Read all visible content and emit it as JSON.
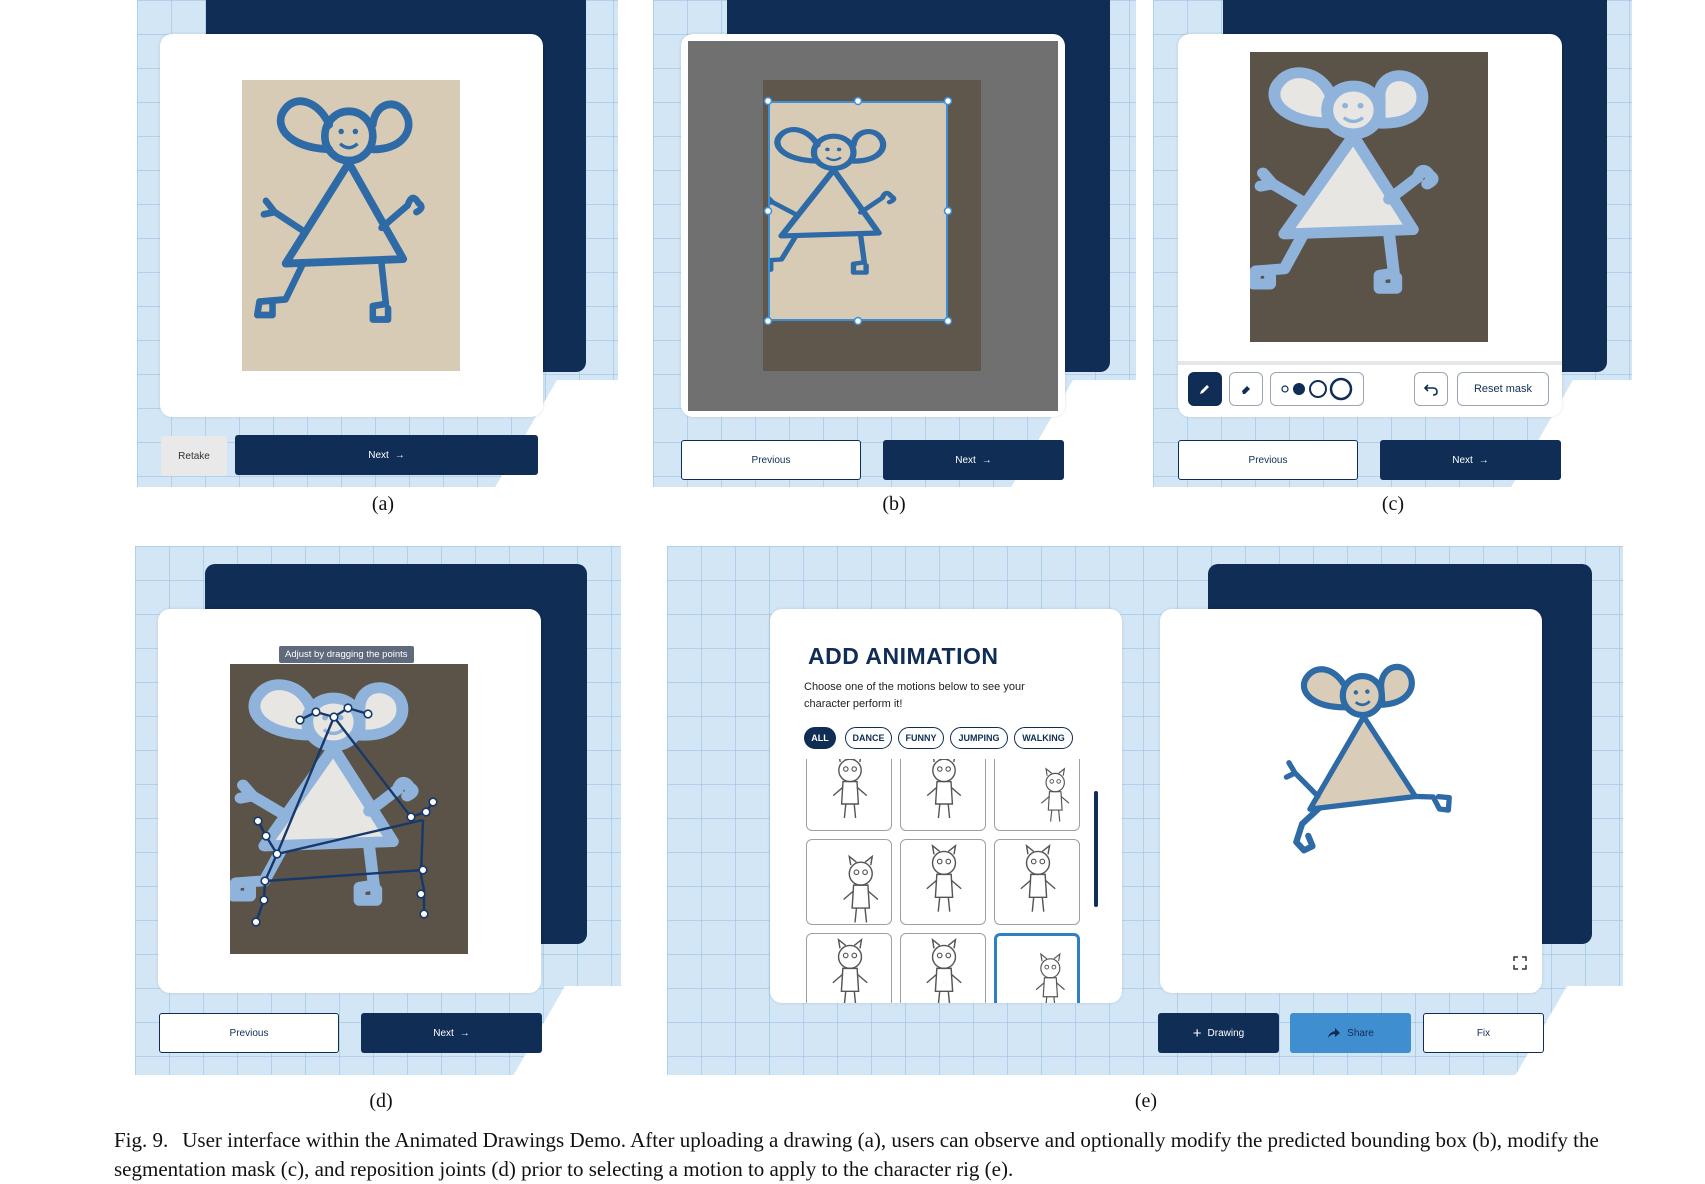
{
  "panels": {
    "a": {
      "label": "(a)",
      "retake": "Retake",
      "next": "Next",
      "arrow": "→"
    },
    "b": {
      "label": "(b)",
      "previous": "Previous",
      "next": "Next",
      "arrow": "→"
    },
    "c": {
      "label": "(c)",
      "previous": "Previous",
      "next": "Next",
      "arrow": "→",
      "reset_mask": "Reset mask",
      "tools": [
        "pencil-icon",
        "eraser-icon",
        "brush-size-icon",
        "undo-icon"
      ]
    },
    "d": {
      "label": "(d)",
      "tooltip": "Adjust by dragging the points",
      "previous": "Previous",
      "next": "Next",
      "arrow": "→"
    },
    "e": {
      "label": "(e)",
      "title": "ADD ANIMATION",
      "description": "Choose one of the motions below to see your character perform it!",
      "filters": [
        "ALL",
        "DANCE",
        "FUNNY",
        "JUMPING",
        "WALKING"
      ],
      "active_filter": "ALL",
      "add_drawing": "Drawing",
      "plus": "+",
      "share": "Share",
      "fix": "Fix",
      "expand_icon": "expand-icon"
    }
  },
  "caption": {
    "label": "Fig. 9.",
    "text": "User interface within the Animated Drawings Demo. After uploading a drawing (a), users can observe and optionally modify the predicted bounding box (b), modify the segmentation mask (c), and reposition joints (d) prior to selecting a motion to apply to the character rig (e)."
  },
  "colors": {
    "navy": "#0f2d55",
    "grid_bg": "#d3e6f6",
    "drawing_blue": "#2e6aa6",
    "mask_blue": "#8fb3da",
    "paper": "#d9ccb8",
    "share_blue": "#3f8fd0"
  }
}
